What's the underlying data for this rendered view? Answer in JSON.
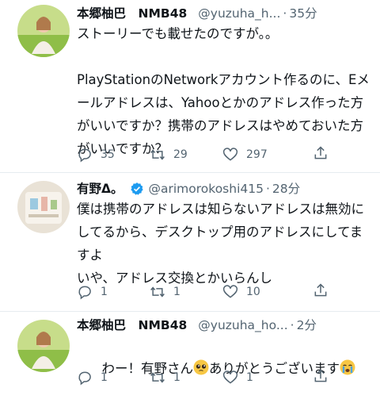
{
  "tweets": [
    {
      "name": "本郷柚巴　NMB48",
      "handle": "@yuzuha_h...",
      "separator": "·",
      "time": "35分",
      "text": "ストーリーでも載せたのですが。。\n\nPlayStationのNetworkアカウント作るのに、Eメールアドレスは、Yahooとかのアドレス作った方がいいですか？携帯のアドレスはやめておいた方がいいですか？",
      "replies": "35",
      "retweets": "29",
      "likes": "297",
      "avatar_icon": "user-avatar-photo"
    },
    {
      "name": "有野Δ。",
      "handle": "@arimorokoshi415",
      "separator": "·",
      "time": "28分",
      "text": "僕は携帯のアドレスは知らないアドレスは無効にしてるから、デスクトップ用のアドレスにしてますよ\nいや、アドレス交換とかいらんし",
      "replies": "1",
      "retweets": "1",
      "likes": "10",
      "avatar_icon": "user-avatar-photo"
    },
    {
      "name": "本郷柚巴　NMB48",
      "handle": "@yuzuha_ho...",
      "separator": "·",
      "time": "2分",
      "text_part1": "わー！有野さん",
      "text_part2": "ありがとうございます",
      "replies": "1",
      "retweets": "1",
      "likes": "1",
      "avatar_icon": "user-avatar-photo"
    }
  ],
  "colors": {
    "secondary": "#536471",
    "verified": "#1d9bf0",
    "text": "#0f1419"
  }
}
